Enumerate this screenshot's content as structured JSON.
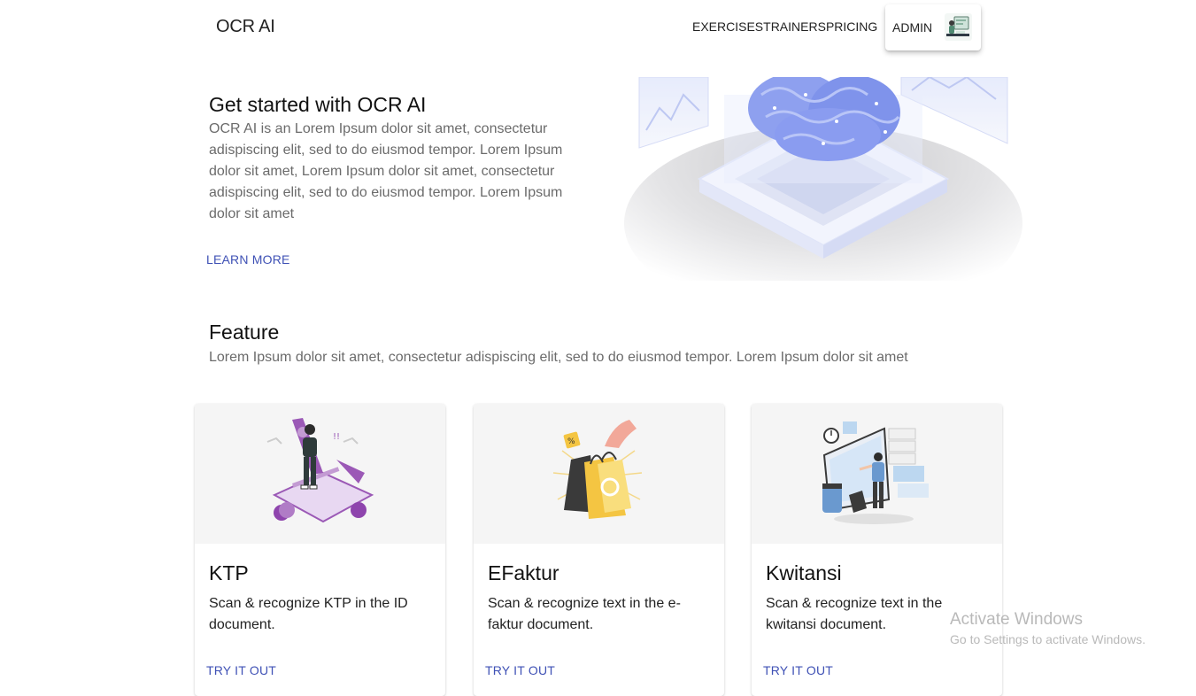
{
  "header": {
    "brand": "OCR AI",
    "nav": [
      "EXERCISES",
      "TRAINERS",
      "PRICING"
    ],
    "admin_label": "ADMIN"
  },
  "hero": {
    "title": "Get started with OCR AI",
    "text": "OCR AI is an Lorem Ipsum dolor sit amet, consectetur adispiscing elit, sed to do eiusmod tempor. Lorem Ipsum dolor sit amet, Lorem Ipsum dolor sit amet, consectetur adispiscing elit, sed to do eiusmod tempor. Lorem Ipsum dolor sit amet",
    "action": "LEARN MORE"
  },
  "feature": {
    "title": "Feature",
    "text": "Lorem Ipsum dolor sit amet, consectetur adispiscing elit, sed to do eiusmod tempor. Lorem Ipsum dolor sit amet",
    "cards": [
      {
        "title": "KTP",
        "description": "Scan & recognize KTP in the ID document.",
        "action": "TRY IT OUT",
        "icon": "person-finance-illustration"
      },
      {
        "title": "EFaktur",
        "description": "Scan & recognize text in the e-faktur document.",
        "action": "TRY IT OUT",
        "icon": "shopping-bags-illustration"
      },
      {
        "title": "Kwitansi",
        "description": "Scan & recognize text in the kwitansi document.",
        "action": "TRY IT OUT",
        "icon": "office-worker-illustration"
      }
    ]
  },
  "watermark": {
    "title": "Activate Windows",
    "subtitle": "Go to Settings to activate Windows."
  },
  "colors": {
    "accent": "#3f51b5",
    "muted_text": "#6b6b6b",
    "card_media_bg": "#f5f5f5",
    "illustration_blue": "#8a9cf0",
    "illustration_purple": "#9b59b6",
    "illustration_yellow": "#f4c542"
  }
}
